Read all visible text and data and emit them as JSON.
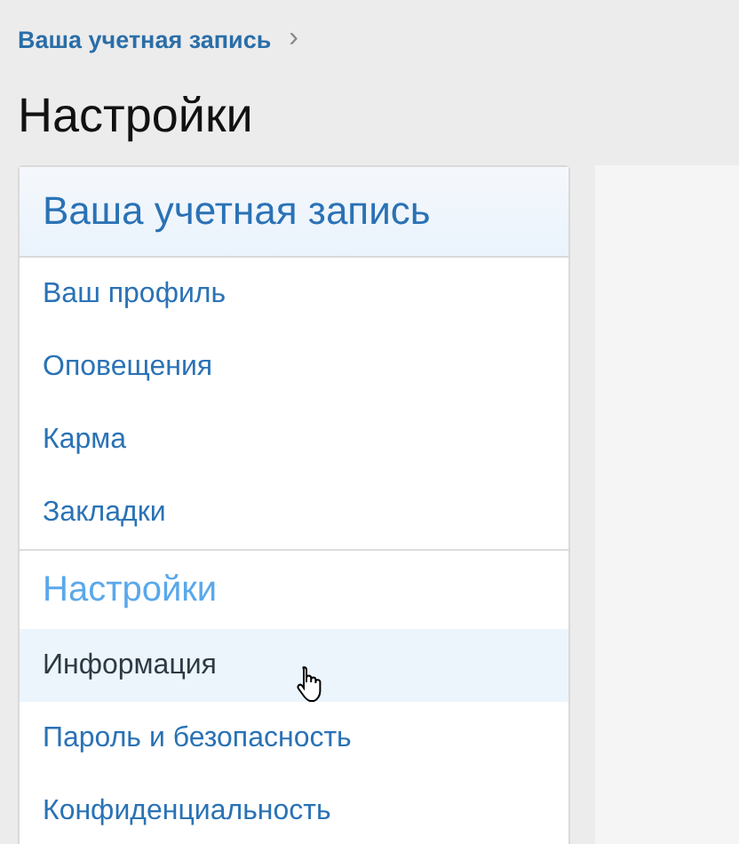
{
  "breadcrumb": {
    "label": "Ваша учетная запись",
    "separator": "›"
  },
  "page_title": "Настройки",
  "sidebar": {
    "sections": [
      {
        "kind": "header",
        "title": "Ваша учетная запись",
        "items": [
          {
            "label": "Ваш профиль",
            "selected": false
          },
          {
            "label": "Оповещения",
            "selected": false
          },
          {
            "label": "Карма",
            "selected": false
          },
          {
            "label": "Закладки",
            "selected": false
          }
        ]
      },
      {
        "kind": "subheader",
        "title": "Настройки",
        "items": [
          {
            "label": "Информация",
            "selected": true
          },
          {
            "label": "Пароль и безопасность",
            "selected": false
          },
          {
            "label": "Конфиденциальность",
            "selected": false
          }
        ]
      }
    ]
  }
}
